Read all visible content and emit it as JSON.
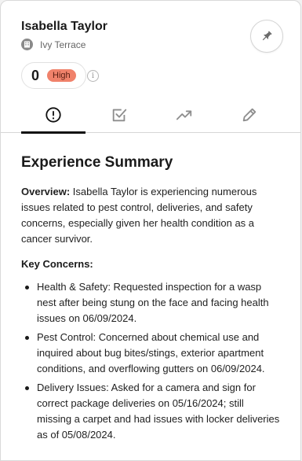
{
  "resident": {
    "name": "Isabella Taylor",
    "property": "Ivy Terrace",
    "score": "0",
    "priority": "High"
  },
  "tabs": [
    {
      "icon": "alert-circle-icon",
      "active": true
    },
    {
      "icon": "checkbox-icon",
      "active": false
    },
    {
      "icon": "trend-up-icon",
      "active": false
    },
    {
      "icon": "pencil-icon",
      "active": false
    }
  ],
  "summary": {
    "title": "Experience Summary",
    "overview_label": "Overview:",
    "overview_text": " Isabella Taylor is experiencing numerous issues related to pest control, deliveries, and safety concerns, especially given her health condition as a cancer survivor.",
    "concerns_label": "Key Concerns:",
    "concerns": [
      "Health & Safety: Requested inspection for a wasp nest after being stung on the face and facing health issues on 06/09/2024.",
      "Pest Control: Concerned about chemical use and inquired about bug bites/stings, exterior apartment conditions, and overflowing gutters on 06/09/2024.",
      "Delivery Issues: Asked for a camera and sign for correct package deliveries on 05/16/2024; still missing a carpet and had issues with locker deliveries as of 05/08/2024."
    ]
  },
  "colors": {
    "badge_bg": "#f0826b",
    "active_tab": "#111111"
  }
}
